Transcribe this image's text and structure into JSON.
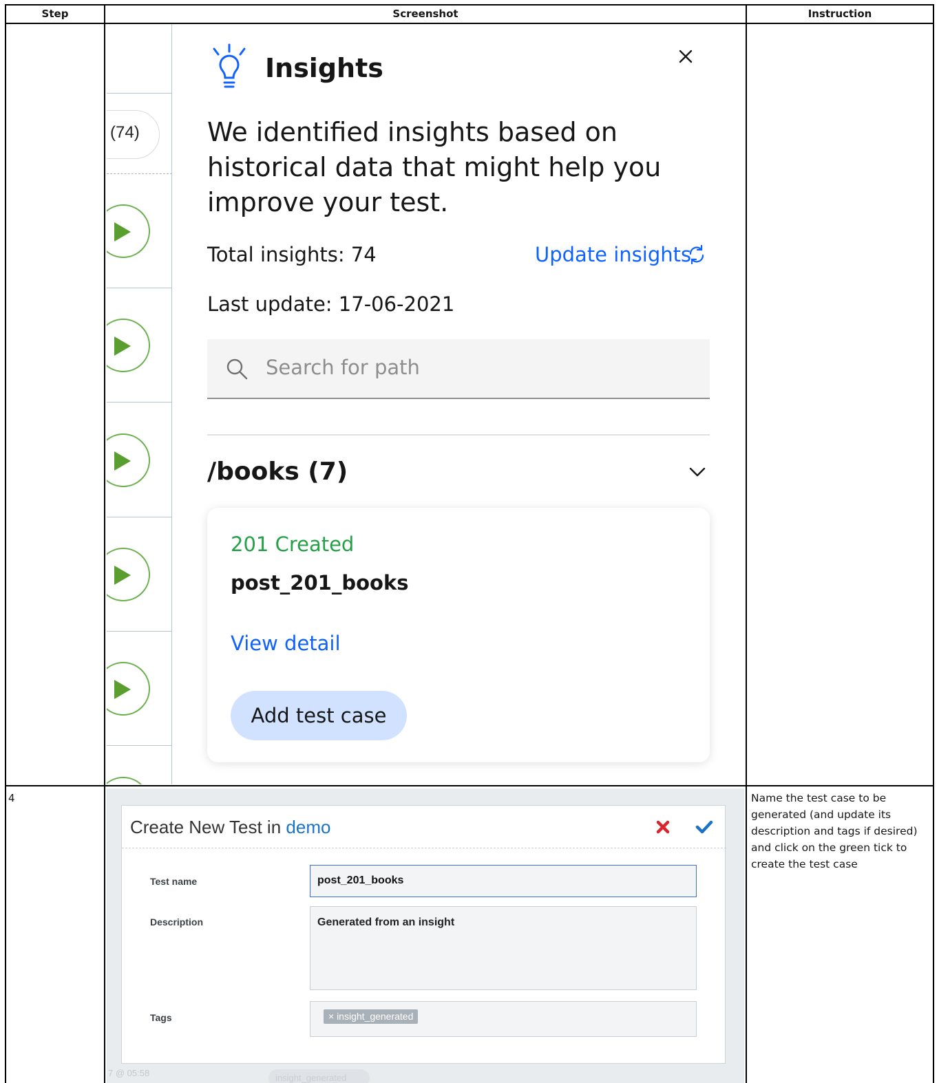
{
  "table": {
    "headers": [
      "Step",
      "Screenshot",
      "Instruction"
    ],
    "row2": {
      "step": "4",
      "instruction": "Name the test case to be generated (and update its description and tags if desired) and click on the green tick to create the test case"
    }
  },
  "insights_panel": {
    "title": "Insights",
    "side_count": "(74)",
    "lead": "We identified insights based on historical data that might help you improve your test.",
    "total": "Total insights: 74",
    "update_link": "Update insights",
    "last_update": "Last update: 17-06-2021",
    "search_placeholder": "Search for path",
    "path_group": "/books (7)",
    "card": {
      "status": "201 Created",
      "name": "post_201_books",
      "view_link": "View detail",
      "add_button": "Add test case"
    },
    "colors": {
      "primary": "#0f62fe",
      "success": "#24a148",
      "play": "#6ab04c",
      "button_bg": "#d0e2ff"
    },
    "icons": [
      "lightbulb-icon",
      "close-icon",
      "refresh-icon",
      "search-icon",
      "chevron-down-icon",
      "play-icon"
    ]
  },
  "create_dialog": {
    "title_prefix": "Create New Test in ",
    "title_project": "demo",
    "name_label": "Test name",
    "name_value": "post_201_books",
    "description_label": "Description",
    "description_value": "Generated from an insight",
    "tags_label": "Tags",
    "tag_value": "× insight_generated",
    "background_time": "7 @ 05:58",
    "background_tag": "insight_generated",
    "colors": {
      "cancel": "#d9262c",
      "confirm": "#1a73c8"
    },
    "icons": [
      "cancel-icon",
      "confirm-check-icon"
    ]
  }
}
